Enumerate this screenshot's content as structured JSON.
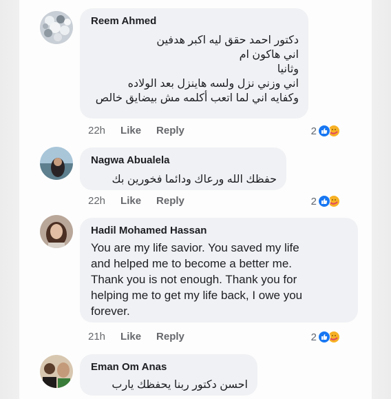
{
  "comments": [
    {
      "author": "Reem Ahmed",
      "text": "دكتور احمد حقق ليه اكبر هدفين\nاني هاكون ام\nوثانيا\nاني وزني نزل ولسه هاينزل بعد الولاده\nوكفايه اني لما اتعب أكلمه مش بيضايق خالص",
      "time": "22h",
      "like": "Like",
      "reply": "Reply",
      "reactions": "2"
    },
    {
      "author": "Nagwa Abualela",
      "text": "حفظك الله ورعاك ودائما فخورين بك",
      "time": "22h",
      "like": "Like",
      "reply": "Reply",
      "reactions": "2"
    },
    {
      "author": "Hadil Mohamed Hassan",
      "text": "You are my life savior. You saved my life\nand helped me to become a better me.\nThank you is not enough. Thank you for\nhelping me to get my life back, I owe you\nforever.",
      "time": "21h",
      "like": "Like",
      "reply": "Reply",
      "reactions": "2"
    },
    {
      "author": "Eman Om Anas",
      "text": "احسن دكتور ربنا يحفظك يارب"
    }
  ],
  "icons": {
    "like": "like-reaction-icon",
    "care": "care-reaction-icon"
  },
  "colors": {
    "bubble": "#f0f1f4",
    "like_blue": "#1877f2",
    "care_yellow": "#f7b125",
    "meta_gray": "#65676b"
  }
}
